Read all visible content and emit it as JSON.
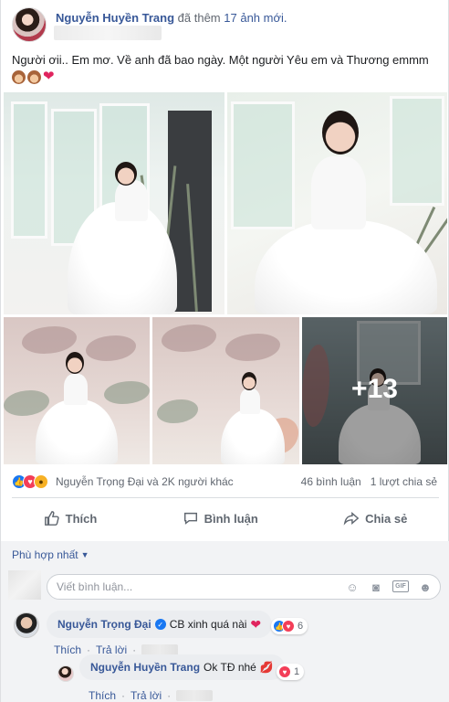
{
  "post": {
    "author": "Nguyễn Huyền Trang",
    "action": "đã thêm",
    "photos_link": "17 ảnh mới.",
    "text": "Người ơii.. Em mơ. Về anh đã bao ngày. Một người Yêu em và Thương emmm",
    "more_photos": "+13"
  },
  "reactions": {
    "summary": "Nguyễn Trọng Đại và 2K người khác",
    "comments_count": "46 bình luận",
    "shares_count": "1 lượt chia sẻ"
  },
  "actions": {
    "like": "Thích",
    "comment": "Bình luận",
    "share": "Chia sẻ"
  },
  "comments_section": {
    "sort_label": "Phù hợp nhất",
    "input_placeholder": "Viết bình luận...",
    "gif_label": "GIF"
  },
  "comments": [
    {
      "author": "Nguyễn Trọng Đại",
      "text": "CB xinh quá nài",
      "reaction_count": "6",
      "like_label": "Thích",
      "reply_label": "Trả lời"
    },
    {
      "author": "Nguyễn Huyền Trang",
      "text": "Ok TĐ nhé",
      "reaction_count": "1",
      "like_label": "Thích",
      "reply_label": "Trả lời"
    }
  ],
  "icons": [
    "monkey-emoji",
    "heart-emoji",
    "like-icon",
    "love-icon",
    "wow-icon",
    "thumbs-up-icon",
    "comment-icon",
    "share-icon",
    "emoji-icon",
    "camera-icon",
    "gif-icon",
    "sticker-icon",
    "verified-icon",
    "kiss-icon"
  ],
  "colors": {
    "link_blue": "#385898",
    "facebook_blue": "#1877f2",
    "love_red": "#f33e58",
    "comment_bg": "#f2f3f5"
  }
}
